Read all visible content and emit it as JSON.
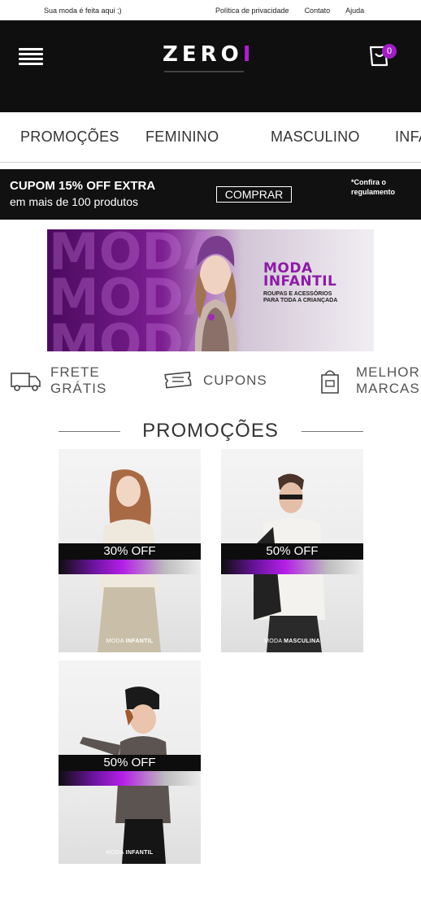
{
  "topbar": {
    "tagline": "Sua moda é feita aqui ;)",
    "links": [
      "Política de privacidade",
      "Contato",
      "Ajuda"
    ]
  },
  "header": {
    "logo_main": "ZERO",
    "logo_accent": "I",
    "cart_count": "0",
    "menu_icon": "hamburger-icon",
    "cart_icon": "cart-icon"
  },
  "categories": [
    "PROMOÇÕES",
    "FEMININO",
    "MASCULINO",
    "INFANTIL"
  ],
  "promo_bar": {
    "title": "CUPOM 15% OFF EXTRA",
    "subtitle": "em mais de 100 produtos",
    "button": "COMPRAR",
    "note": "*Confira o regulamento"
  },
  "banner": {
    "bg_word": "MODA",
    "title_line1": "MODA",
    "title_line2": "INFANTIL",
    "sub_line1": "ROUPAS E ACESSÓRIOS",
    "sub_line2": "PARA TODA A CRIANÇADA"
  },
  "features": [
    {
      "icon": "truck-icon",
      "line1": "FRETE",
      "line2": "GRÁTIS"
    },
    {
      "icon": "ticket-icon",
      "line1": "CUPONS",
      "line2": ""
    },
    {
      "icon": "tag-icon",
      "line1": "MELHORES",
      "line2": "MARCAS"
    }
  ],
  "section_title": "PROMOÇÕES",
  "cards": [
    {
      "discount": "30% OFF",
      "label_prefix": "MODA ",
      "label_bold": "INFANTIL"
    },
    {
      "discount": "50% OFF",
      "label_prefix": "MODA ",
      "label_bold": "MASCULINA"
    },
    {
      "discount": "50% OFF",
      "label_prefix": "MODA ",
      "label_bold": "INFANTIL"
    }
  ],
  "colors": {
    "header_bg": "#0f0f0f",
    "accent_purple": "#a21dc6",
    "promo_bg": "#111111"
  }
}
